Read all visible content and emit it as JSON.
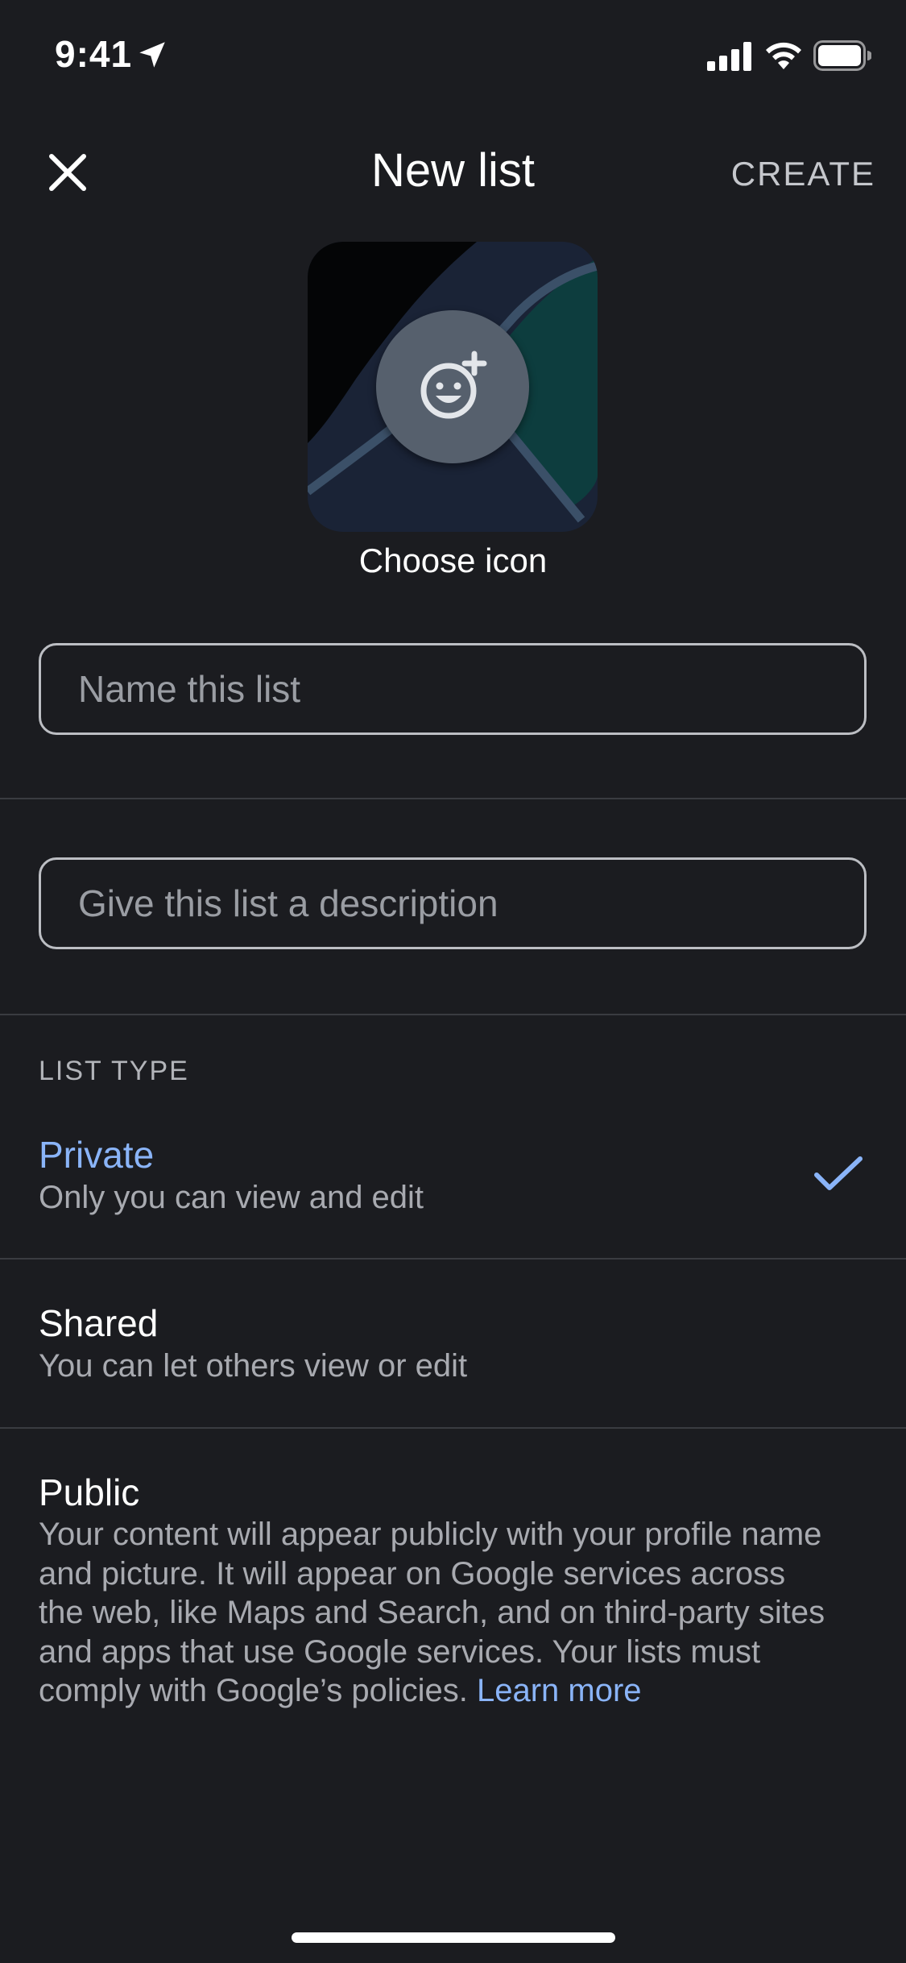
{
  "status_bar": {
    "time": "9:41"
  },
  "header": {
    "title": "New list",
    "create_label": "CREATE"
  },
  "icon_chooser": {
    "label": "Choose icon"
  },
  "form": {
    "name_placeholder": "Name this list",
    "description_placeholder": "Give this list a description"
  },
  "list_type": {
    "section_label": "LIST TYPE",
    "options": [
      {
        "title": "Private",
        "subtitle": "Only you can view and edit",
        "selected": true
      },
      {
        "title": "Shared",
        "subtitle": "You can let others view or edit",
        "selected": false
      },
      {
        "title": "Public",
        "subtitle": "Your content will appear publicly with your profile name and picture. It will appear on Google services across the web, like Maps and Search, and on third-party sites and apps that use Google services. Your lists must comply with Google’s policies.",
        "link_label": "Learn more",
        "selected": false
      }
    ]
  },
  "colors": {
    "background": "#1b1c20",
    "accent": "#8ab4f8",
    "divider": "#3a3c41",
    "secondary_text": "#a8aab0"
  },
  "icons": {
    "close": "close-icon",
    "emoji_add": "add-emoji-icon",
    "selected_check": "check-icon",
    "location": "location-arrow-icon",
    "signal": "cellular-signal-icon",
    "wifi": "wifi-icon",
    "battery": "battery-icon"
  }
}
